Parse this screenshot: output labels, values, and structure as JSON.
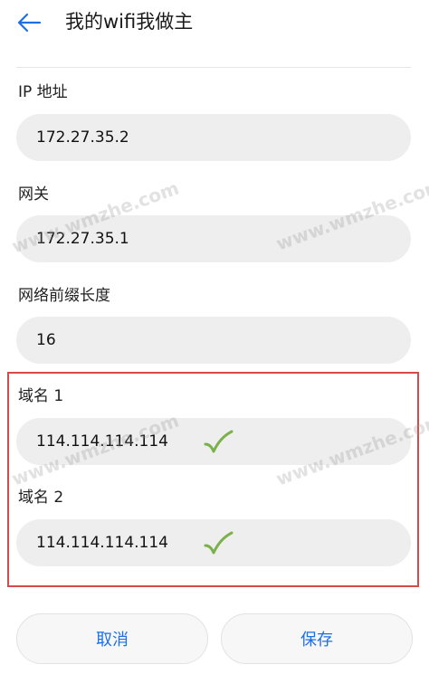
{
  "header": {
    "title": "我的wifi我做主",
    "back_icon": "arrow-left-icon"
  },
  "form": {
    "ip": {
      "label": "IP 地址",
      "value": "172.27.35.2"
    },
    "gateway": {
      "label": "网关",
      "value": "172.27.35.1"
    },
    "prefix": {
      "label": "网络前缀长度",
      "value": "16"
    },
    "dns1": {
      "label": "域名 1",
      "value": "114.114.114.114"
    },
    "dns2": {
      "label": "域名 2",
      "value": "114.114.114.114"
    }
  },
  "buttons": {
    "cancel": "取消",
    "save": "保存"
  },
  "watermark": "www.wmzhe.com",
  "colors": {
    "accent": "#1d6fe6",
    "highlight": "#d64a4a",
    "check": "#7bb04a"
  }
}
